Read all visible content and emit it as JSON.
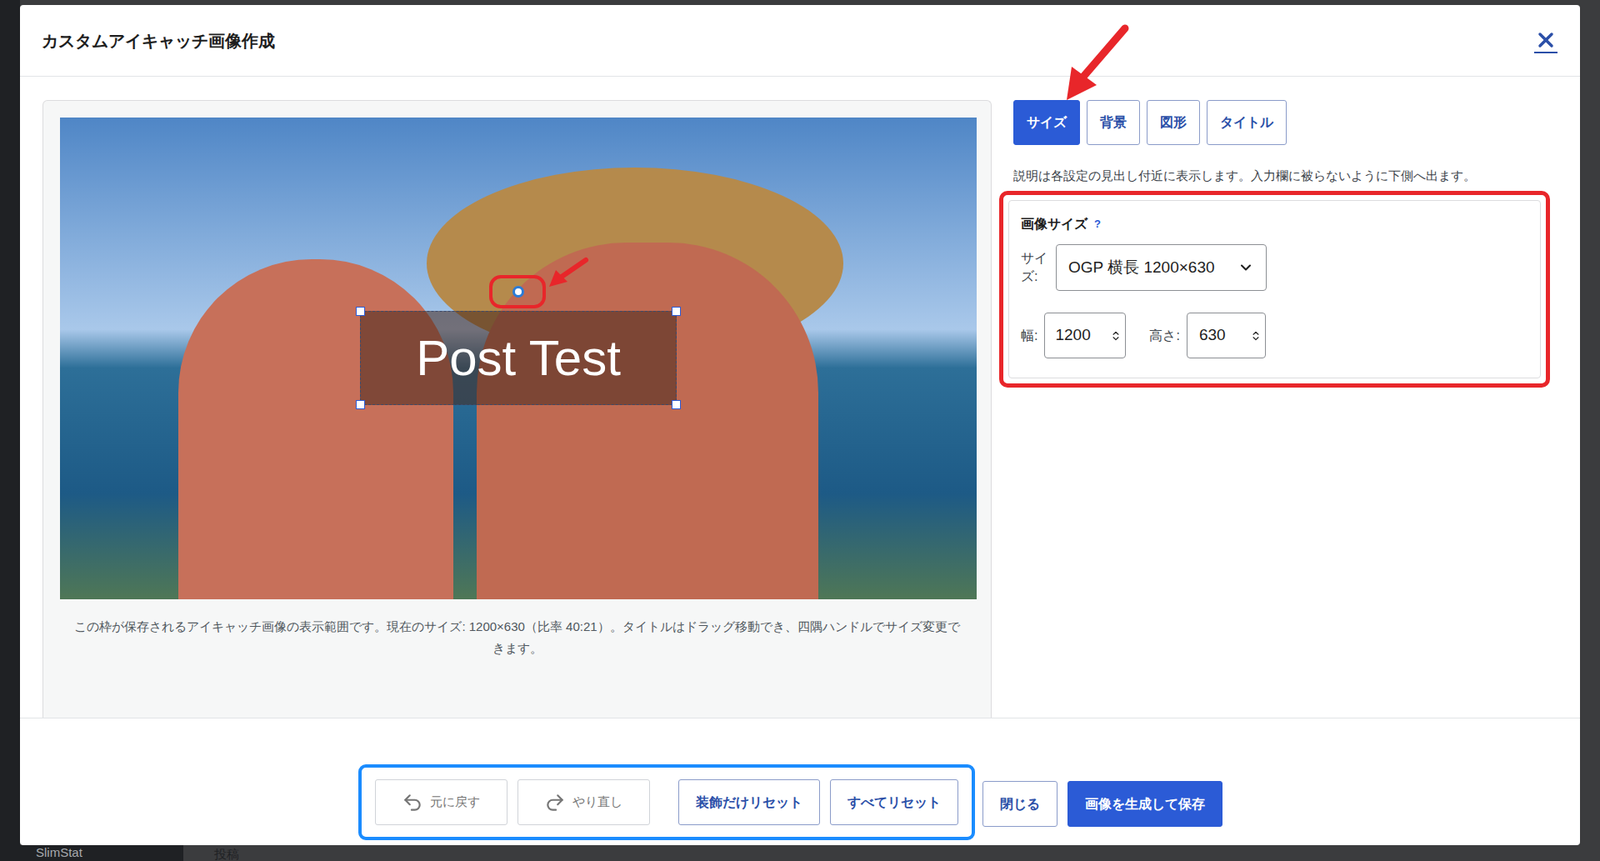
{
  "window": {
    "title": "カスタムアイキャッチ画像作成"
  },
  "preview": {
    "overlay_title": "Post Test",
    "caption": "この枠が保存されるアイキャッチ画像の表示範囲です。現在のサイズ: 1200×630（比率 40:21）。タイトルはドラッグ移動でき、四隅ハンドルでサイズ変更できます。"
  },
  "tabs": [
    {
      "label": "サイズ",
      "selected": true
    },
    {
      "label": "背景",
      "selected": false
    },
    {
      "label": "図形",
      "selected": false
    },
    {
      "label": "タイトル",
      "selected": false
    }
  ],
  "help_text": "説明は各設定の見出し付近に表示します。入力欄に被らないように下側へ出ます。",
  "size_panel": {
    "heading": "画像サイズ",
    "help_mark": "?",
    "size_label": "サイズ:",
    "size_value": "OGP 横長 1200×630",
    "width_label": "幅:",
    "width_value": "1200",
    "height_label": "高さ:",
    "height_value": "630"
  },
  "footer": {
    "grouped_buttons": [
      {
        "label": "元に戻す",
        "kind": "undo",
        "disabled": true
      },
      {
        "label": "やり直し",
        "kind": "redo",
        "disabled": true
      },
      {
        "label": "装飾だけリセット",
        "kind": "outline",
        "disabled": false
      },
      {
        "label": "すべてリセット",
        "kind": "outline",
        "disabled": false
      }
    ],
    "buttons": [
      {
        "label": "閉じる",
        "kind": "outline",
        "disabled": false
      },
      {
        "label": "画像を生成して保存",
        "kind": "primary",
        "disabled": false
      }
    ]
  },
  "background_menu": [
    "SlimStat",
    "投稿"
  ]
}
